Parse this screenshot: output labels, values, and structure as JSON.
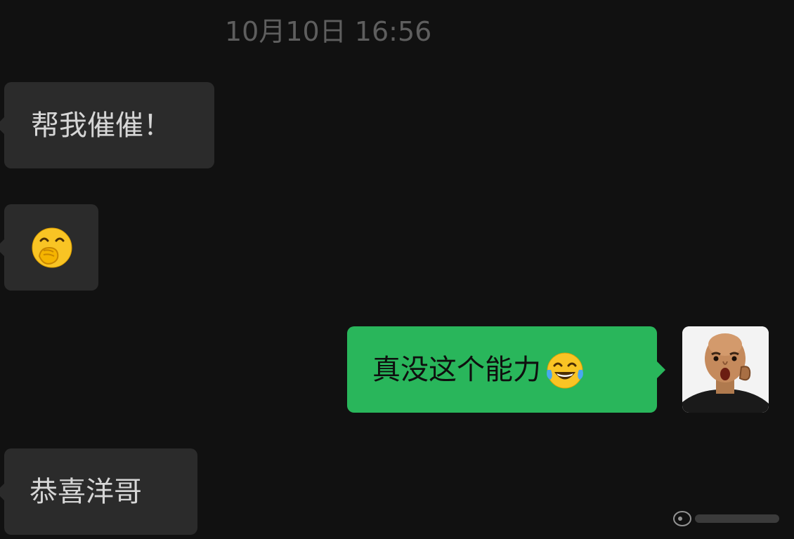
{
  "timestamp": "10月10日 16:56",
  "messages": [
    {
      "direction": "incoming",
      "text": "帮我催催！"
    },
    {
      "direction": "incoming",
      "emoji": "hand-over-mouth-emoji"
    },
    {
      "direction": "outgoing",
      "text": "真没这个能力",
      "emoji": "tears-of-joy-emoji"
    },
    {
      "direction": "incoming",
      "text": "恭喜洋哥"
    }
  ],
  "colors": {
    "background": "#111111",
    "incoming_bubble": "#2b2b2b",
    "outgoing_bubble": "#29b65b",
    "timestamp": "#5e5e5e"
  }
}
